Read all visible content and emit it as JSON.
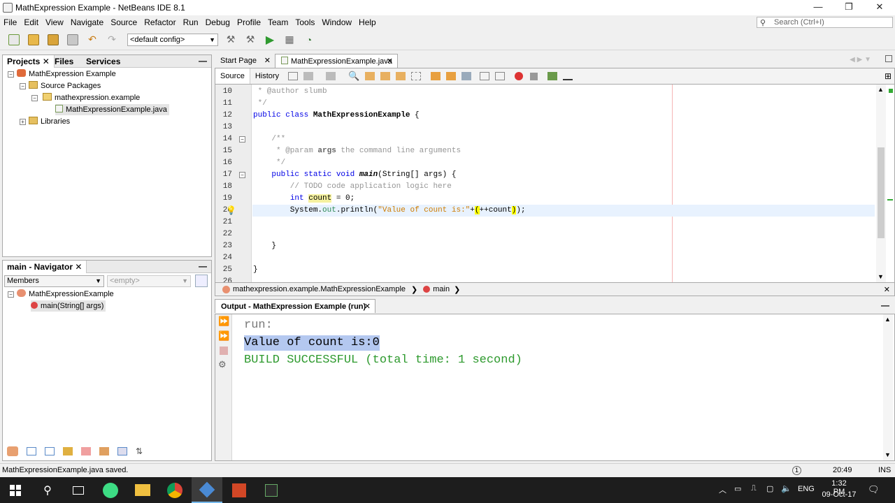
{
  "window": {
    "title": "MathExpression Example - NetBeans IDE 8.1",
    "minimize": "—",
    "restore": "❐",
    "close": "✕"
  },
  "menu": [
    "File",
    "Edit",
    "View",
    "Navigate",
    "Source",
    "Refactor",
    "Run",
    "Debug",
    "Profile",
    "Team",
    "Tools",
    "Window",
    "Help"
  ],
  "search": {
    "placeholder": "Search (Ctrl+I)"
  },
  "toolbar": {
    "config_value": "<default config>"
  },
  "projects_panel": {
    "tabs": [
      "Projects",
      "Files",
      "Services"
    ],
    "tree": [
      {
        "label": "MathExpression Example"
      },
      {
        "label": "Source Packages"
      },
      {
        "label": "mathexpression.example"
      },
      {
        "label": "MathExpressionExample.java"
      },
      {
        "label": "Libraries"
      }
    ]
  },
  "navigator_panel": {
    "title": "main - Navigator",
    "filter": "Members",
    "filter2": "<empty>",
    "tree": [
      {
        "label": "MathExpressionExample"
      },
      {
        "label": "main(String[] args)"
      }
    ]
  },
  "editor": {
    "tabs": [
      "Start Page",
      "MathExpressionExample.java"
    ],
    "view_tabs": [
      "Source",
      "History"
    ],
    "lines": [
      {
        "n": "10",
        "text": " * @author slumb"
      },
      {
        "n": "11",
        "text": " */"
      },
      {
        "n": "12",
        "text": "public class MathExpressionExample {"
      },
      {
        "n": "13",
        "text": ""
      },
      {
        "n": "14",
        "text": "    /**"
      },
      {
        "n": "15",
        "text": "     * @param args the command line arguments"
      },
      {
        "n": "16",
        "text": "     */"
      },
      {
        "n": "17",
        "text": "    public static void main(String[] args) {"
      },
      {
        "n": "18",
        "text": "        // TODO code application logic here"
      },
      {
        "n": "19",
        "text": "        int count = 0;"
      },
      {
        "n": "20",
        "text": "        System.out.println(\"Value of count is:\"+(++count));"
      },
      {
        "n": "21",
        "text": ""
      },
      {
        "n": "22",
        "text": ""
      },
      {
        "n": "23",
        "text": "    }"
      },
      {
        "n": "24",
        "text": ""
      },
      {
        "n": "25",
        "text": "}"
      },
      {
        "n": "26",
        "text": ""
      }
    ],
    "breadcrumb": [
      "mathexpression.example.MathExpressionExample",
      "main"
    ]
  },
  "output": {
    "title": "Output - MathExpression Example (run)",
    "lines": [
      "run:",
      "Value of count is:0",
      "BUILD SUCCESSFUL (total time: 1 second)"
    ]
  },
  "status": {
    "message": "MathExpressionExample.java saved.",
    "position": "20:49",
    "mode": "INS"
  },
  "taskbar": {
    "lang": "ENG",
    "time": "1:32 PM",
    "date": "09-Oct-17"
  },
  "colors": {
    "keyword": "#0000e6",
    "string": "#ce7b00",
    "comment": "#969696",
    "success": "#2e9a2e",
    "selection": "#b4c8f0"
  }
}
